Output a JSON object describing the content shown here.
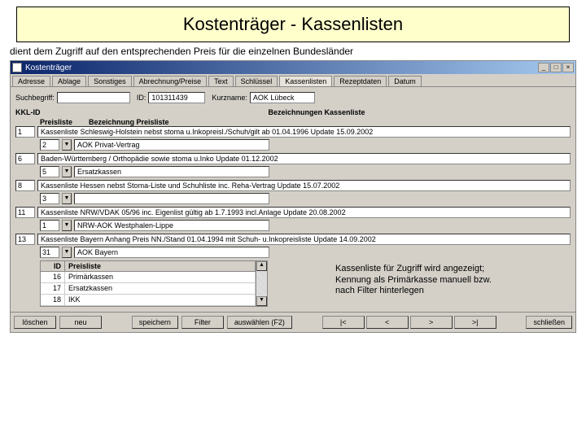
{
  "slide": {
    "title": "Kostenträger - Kassenlisten",
    "subtitle": "dient dem Zugriff auf den entsprechenden Preis für die einzelnen Bundesländer"
  },
  "window": {
    "title": "Kostenträger"
  },
  "winbtns": {
    "min": "_",
    "max": "□",
    "close": "×"
  },
  "tabs": {
    "t0": "Adresse",
    "t1": "Ablage",
    "t2": "Sonstiges",
    "t3": "Abrechnung/Preise",
    "t4": "Text",
    "t5": "Schlüssel",
    "t6": "Kassenlisten",
    "t7": "Rezeptdaten",
    "t8": "Datum"
  },
  "top": {
    "suchLabel": "Suchbegriff:",
    "suchVal": "",
    "idLabel": "ID:",
    "idVal": "101311439",
    "kurzLabel": "Kurzname:",
    "kurzVal": "AOK Lübeck"
  },
  "hdr": {
    "kkl": "KKL-ID",
    "bez": "Bezeichnungen Kassenliste",
    "pl": "Preisliste",
    "bezpl": "Bezeichnung Preisliste"
  },
  "r1": {
    "id": "1",
    "txt": "Kassenliste Schleswig-Holstein nebst stoma u.Inkopreisl./Schuh/gilt ab 01.04.1996   Update 15.09.2002",
    "sub": "2",
    "subtxt": "AOK Privat-Vertrag"
  },
  "r2": {
    "id": "6",
    "txt": "Baden-Württemberg / Orthopädie sowie stoma u.Inko                                  Update 01.12.2002",
    "sub": "5",
    "subtxt": "Ersatzkassen"
  },
  "r3": {
    "id": "8",
    "txt": "Kassenliste Hessen nebst Stoma-Liste und Schuhliste inc. Reha-Vertrag             Update 15.07.2002",
    "sub": "3",
    "subtxt": ""
  },
  "r4": {
    "id": "11",
    "txt": "Kassenliste NRW/VDAK 05/96 inc. Eigenlist        gültig ab 1.7.1993 incl.Anlage   Update 20.08.2002",
    "sub": "1",
    "subtxt": "NRW-AOK Westphalen-Lippe"
  },
  "r5": {
    "id": "13",
    "txt": "Kassenliste Bayern Anhang Preis NN./Stand 01.04.1994 mit Schuh- u.Inkopreisliste  Update 14.09.2002",
    "sub": "31",
    "subtxt": "AOK Bayern"
  },
  "subtbl": {
    "hID": "ID",
    "hPL": "Preisliste",
    "r1id": "16",
    "r1pl": "Primärkassen",
    "r2id": "17",
    "r2pl": "Ersatzkassen",
    "r3id": "18",
    "r3pl": "IKK"
  },
  "annot": {
    "l1": "Kassenliste für Zugriff  wird angezeigt;",
    "l2": "Kennung als Primärkasse manuell bzw.",
    "l3": "nach Filter hinterlegen"
  },
  "footer": {
    "loeschen": "löschen",
    "neu": "neu",
    "speichern": "speichern",
    "filter": "Filter",
    "auswahl": "auswählen (F2)",
    "schliessen": "schließen",
    "first": "|<",
    "prev": "<",
    "next": ">",
    "last": ">|"
  }
}
